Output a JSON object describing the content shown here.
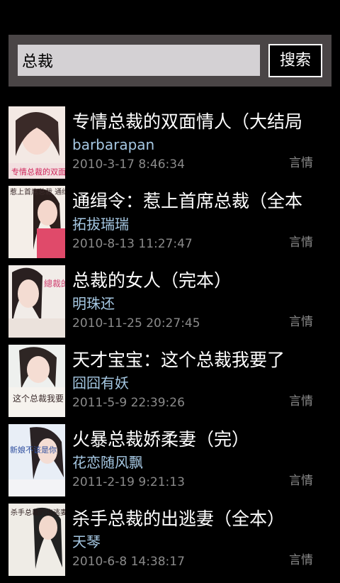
{
  "search": {
    "value": "总裁",
    "button_label": "搜索"
  },
  "results": [
    {
      "title": "专情总裁的双面情人（大结局",
      "author": "barbarapan",
      "date": "2010-3-17 8:46:34",
      "category": "言情",
      "cover_text": "专情总裁的双面人情"
    },
    {
      "title": "通缉令：惹上首席总裁（全本",
      "author": "拓拔瑞瑞",
      "date": "2010-8-13 11:27:47",
      "category": "言情",
      "cover_text": "惹上首席总裁 通缉令"
    },
    {
      "title": "总裁的女人（完本）",
      "author": "明珠还",
      "date": "2010-11-25 20:27:45",
      "category": "言情",
      "cover_text": "總裁的女人"
    },
    {
      "title": "天才宝宝：这个总裁我要了",
      "author": "囧囧有妖",
      "date": "2011-5-9 22:39:26",
      "category": "言情",
      "cover_text": "这个总裁我要"
    },
    {
      "title": "火暴总裁娇柔妻（完）",
      "author": "花恋随风飘",
      "date": "2011-2-19 9:21:13",
      "category": "言情",
      "cover_text": "新娘不该是你"
    },
    {
      "title": "杀手总裁的出逃妻（全本）",
      "author": "天琴",
      "date": "2010-6-8 14:38:17",
      "category": "言情",
      "cover_text": "杀手总裁的出逃妻"
    }
  ]
}
